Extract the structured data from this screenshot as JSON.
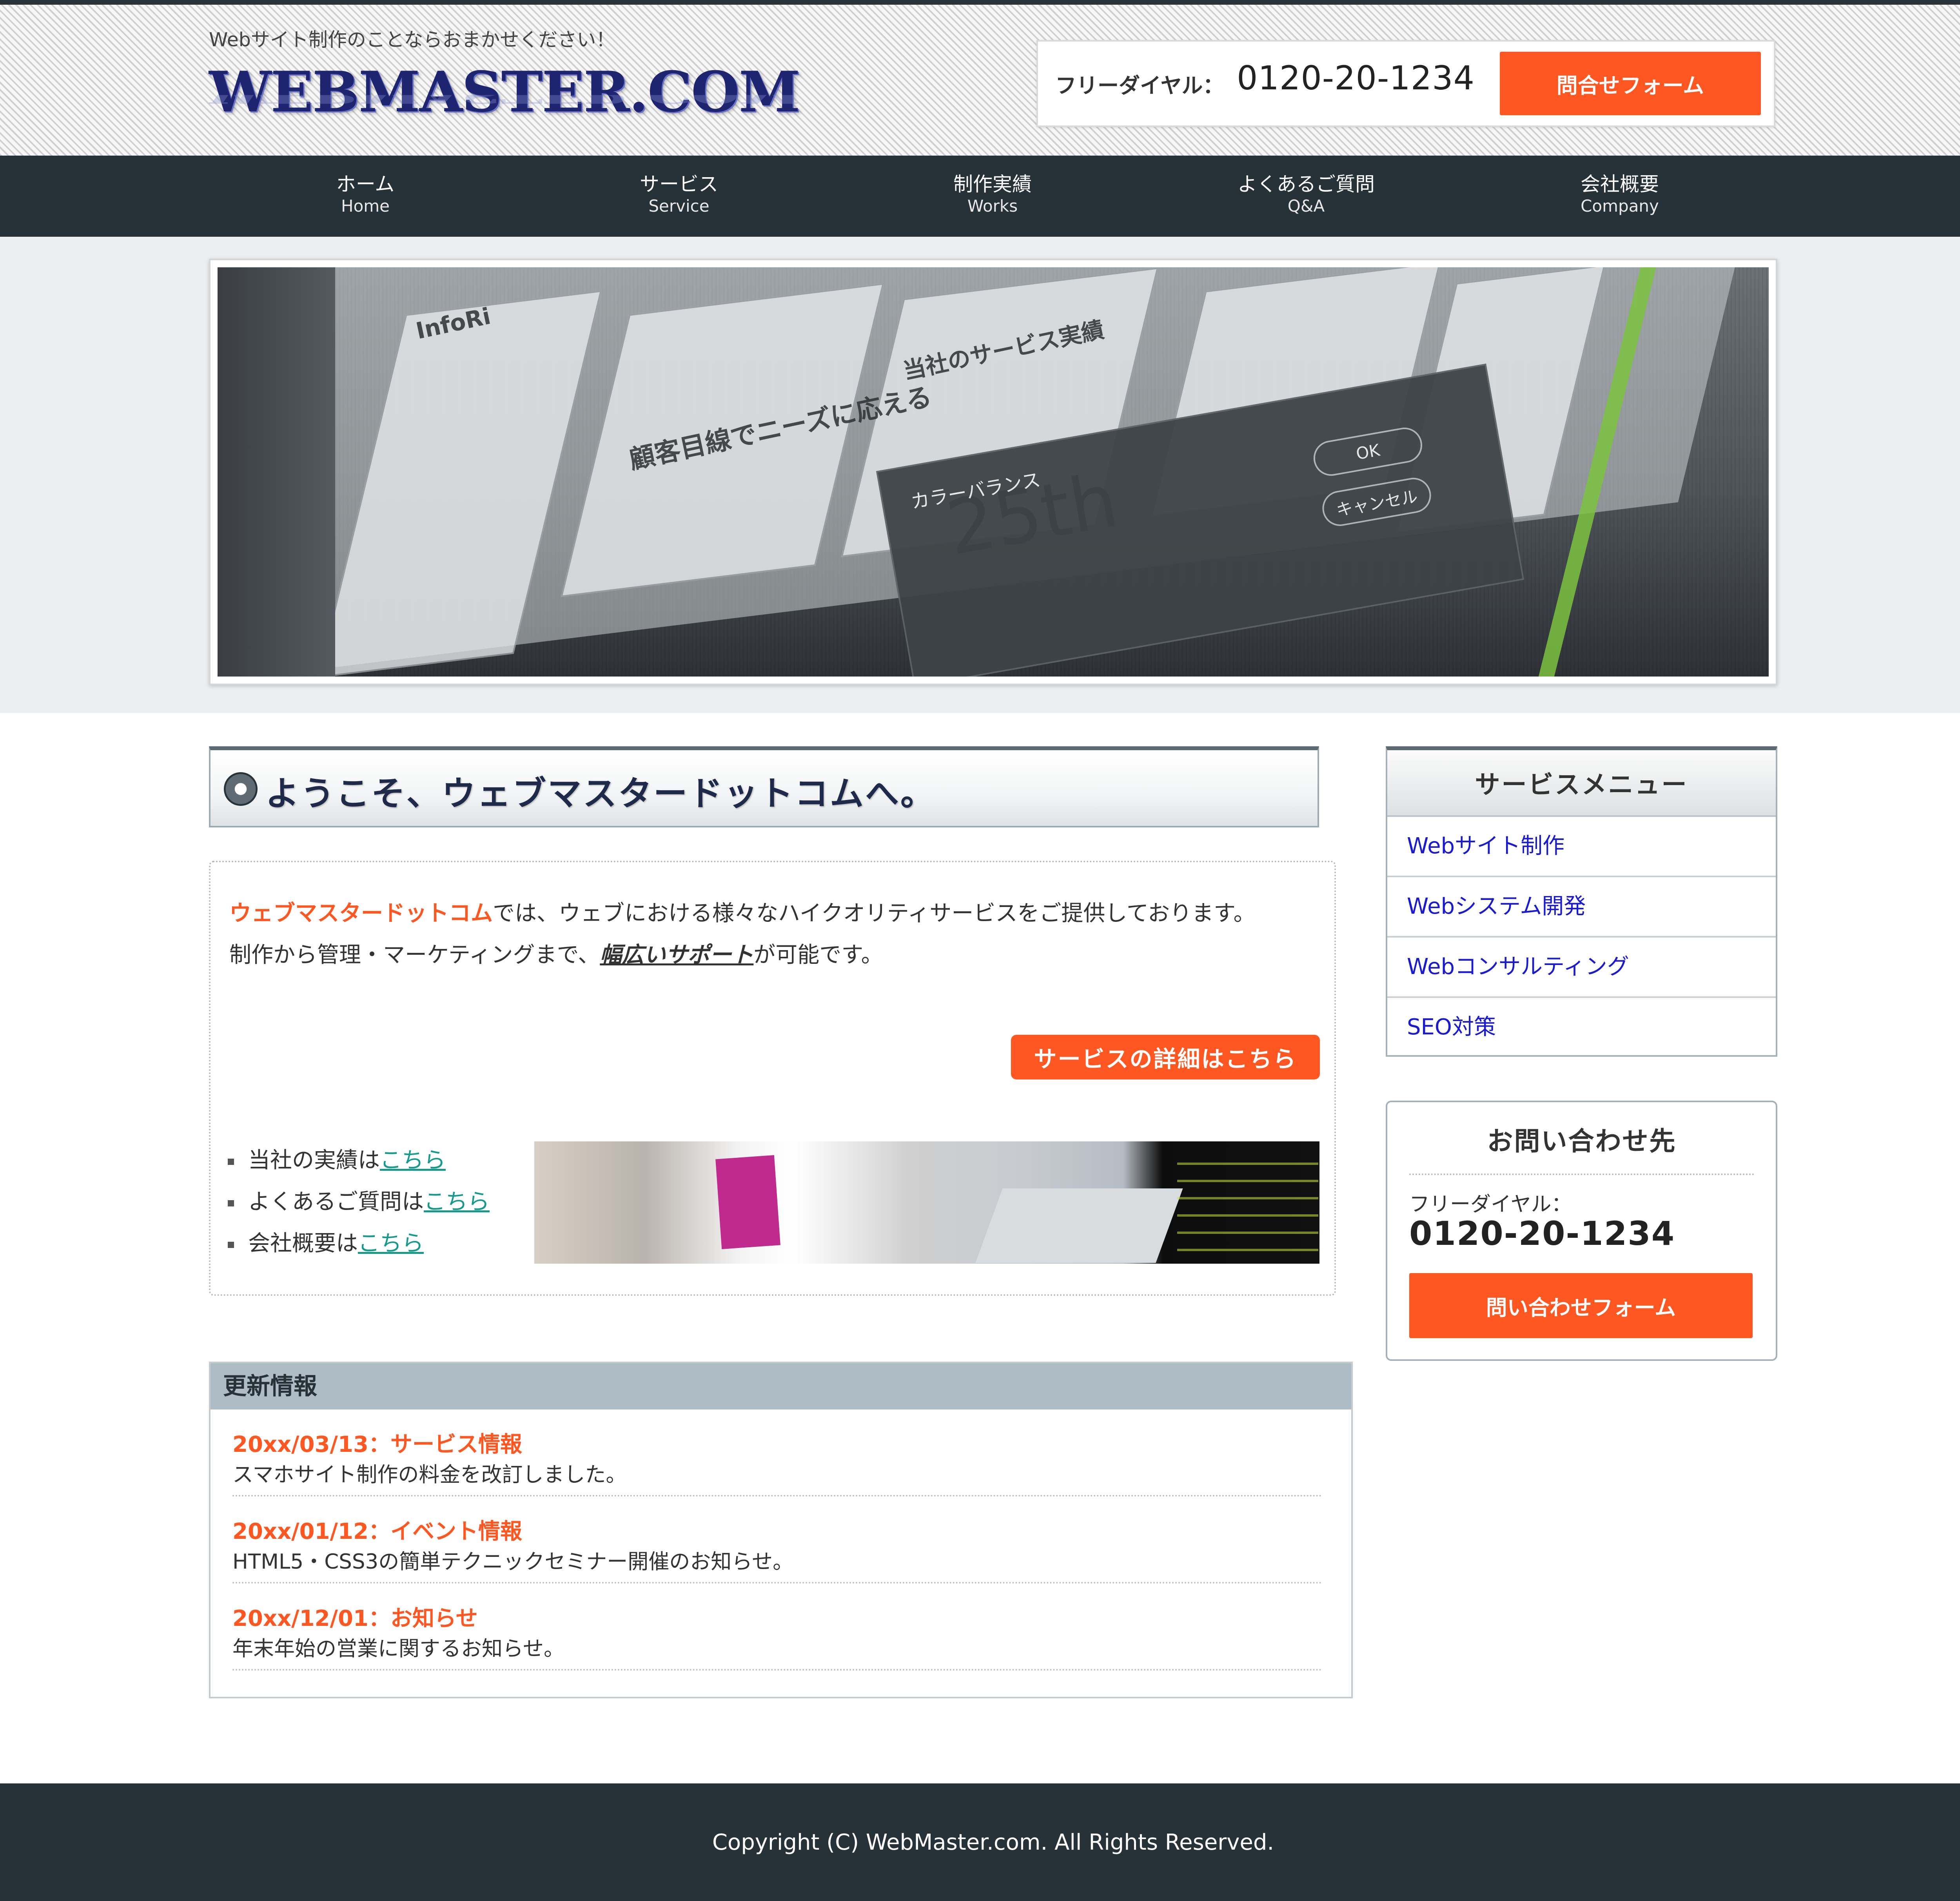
{
  "header": {
    "tagline": "Webサイト制作のことならおまかせください！",
    "logo_text": "WEBMASTER.COM",
    "freedial_label": "フリーダイヤル：",
    "freedial_number": "0120-20-1234",
    "contact_button": "問合せフォーム"
  },
  "nav": {
    "items": [
      {
        "jp": "ホーム",
        "en": "Home"
      },
      {
        "jp": "サービス",
        "en": "Service"
      },
      {
        "jp": "制作実績",
        "en": "Works"
      },
      {
        "jp": "よくあるご質問",
        "en": "Q&A"
      },
      {
        "jp": "会社概要",
        "en": "Company"
      }
    ]
  },
  "hero": {
    "texts": {
      "t1": "顧客目線でニーズに応える",
      "t2": "当社のサービス実績",
      "t3": "25th",
      "t4": "カラーバランス",
      "t5": "OK",
      "t6": "キャンセル",
      "t7": "InfoRi"
    }
  },
  "main": {
    "welcome_title": "ようこそ、ウェブマスタードットコムへ。",
    "intro": {
      "brand": "ウェブマスタードットコム",
      "line1_rest": "では、ウェブにおける様々なハイクオリティサービスをご提供しております。",
      "line2_pre": "制作から管理・マーケティングまで、",
      "line2_emph": "幅広いサポート",
      "line2_post": "が可能です。",
      "cta": "サービスの詳細はこちら",
      "links": [
        {
          "pre": "当社の実績は",
          "link": "こちら"
        },
        {
          "pre": "よくあるご質問は",
          "link": "こちら"
        },
        {
          "pre": "会社概要は",
          "link": "こちら"
        }
      ]
    },
    "news": {
      "title": "更新情報",
      "items": [
        {
          "date": "20xx/03/13：サービス情報",
          "text": "スマホサイト制作の料金を改訂しました。"
        },
        {
          "date": "20xx/01/12：イベント情報",
          "text": "HTML5・CSS3の簡単テクニックセミナー開催のお知らせ。"
        },
        {
          "date": "20xx/12/01：お知らせ",
          "text": "年末年始の営業に関するお知らせ。"
        }
      ]
    }
  },
  "sidebar": {
    "menu_title": "サービスメニュー",
    "menu_items": [
      "Webサイト制作",
      "Webシステム開発",
      "Webコンサルティング",
      "SEO対策"
    ],
    "contact_title": "お問い合わせ先",
    "contact_label": "フリーダイヤル：",
    "contact_number": "0120-20-1234",
    "contact_button": "問い合わせフォーム"
  },
  "footer": {
    "copyright": "Copyright (C) WebMaster.com. All Rights Reserved."
  },
  "colors": {
    "accent": "#ff5722",
    "nav_bg": "#263238",
    "link": "#1a1ad0",
    "teal_link": "#159a8c"
  },
  "icons": {
    "welcome_bullet": "circle-icon",
    "list_bullet": "square-bullet-icon"
  }
}
